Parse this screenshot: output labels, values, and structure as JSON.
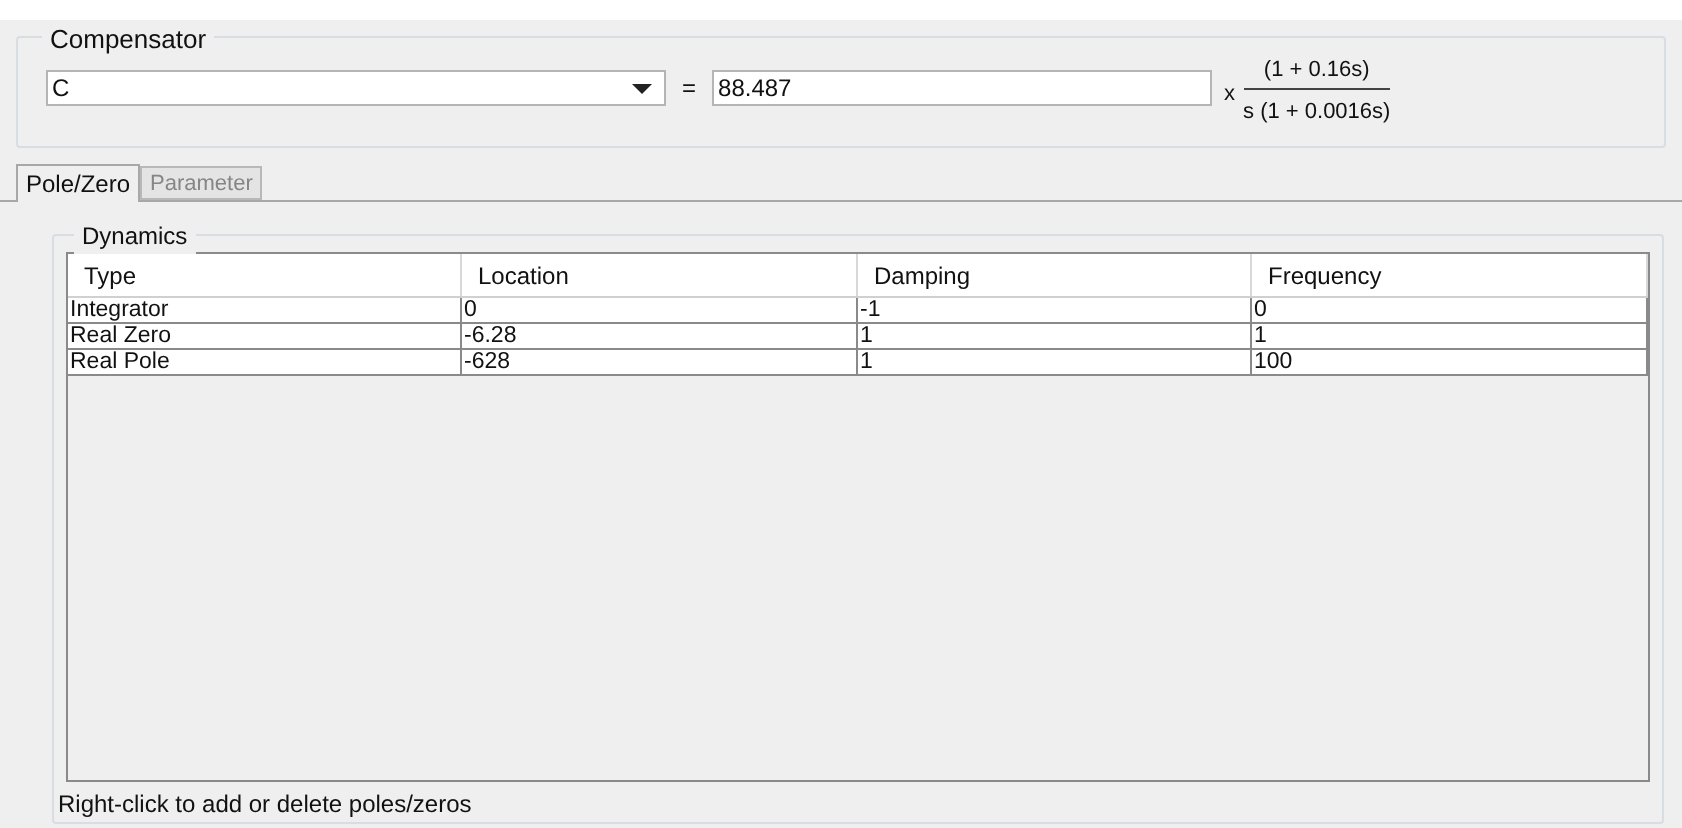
{
  "compensator": {
    "title": "Compensator",
    "name": "C",
    "equals": "=",
    "gain": "88.487",
    "times": "x",
    "numerator": "(1 + 0.16s)",
    "denominator": "s (1 + 0.0016s)"
  },
  "tabs": [
    {
      "label": "Pole/Zero",
      "selected": true,
      "disabled": false
    },
    {
      "label": "Parameter",
      "selected": false,
      "disabled": true
    }
  ],
  "dynamics": {
    "title": "Dynamics",
    "columns": [
      "Type",
      "Location",
      "Damping",
      "Frequency"
    ],
    "rows": [
      [
        "Integrator",
        "0",
        "-1",
        "0"
      ],
      [
        "Real Zero",
        "-6.28",
        "1",
        "1"
      ],
      [
        "Real Pole",
        "-628",
        "1",
        "100"
      ]
    ],
    "hint": "Right-click to add or delete poles/zeros"
  }
}
